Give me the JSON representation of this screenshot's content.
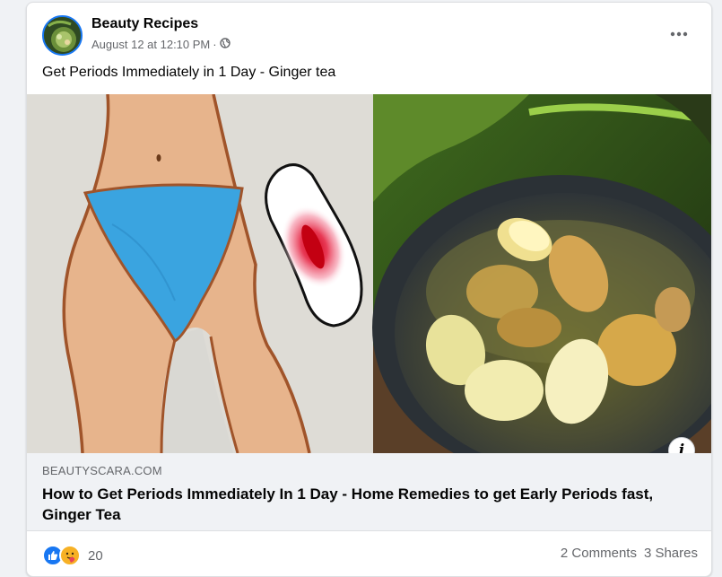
{
  "post": {
    "author": "Beauty Recipes",
    "date": "August 12 at 12:10 PM",
    "separator": "·",
    "privacy_icon": "globe-icon",
    "text": "Get Periods Immediately in 1 Day - Ginger tea"
  },
  "link": {
    "domain": "BEAUTYSCARA.COM",
    "title": "How to Get Periods Immediately In 1 Day - Home Remedies to get Early Periods fast, Ginger Tea"
  },
  "engagement": {
    "reaction_icons": [
      "like-icon",
      "care-icon"
    ],
    "reaction_count": "20",
    "comments": "2 Comments",
    "shares": "3 Shares"
  },
  "colors": {
    "accent": "#1877f2",
    "muted_text": "#65676b",
    "link_box_bg": "#f0f2f5"
  }
}
